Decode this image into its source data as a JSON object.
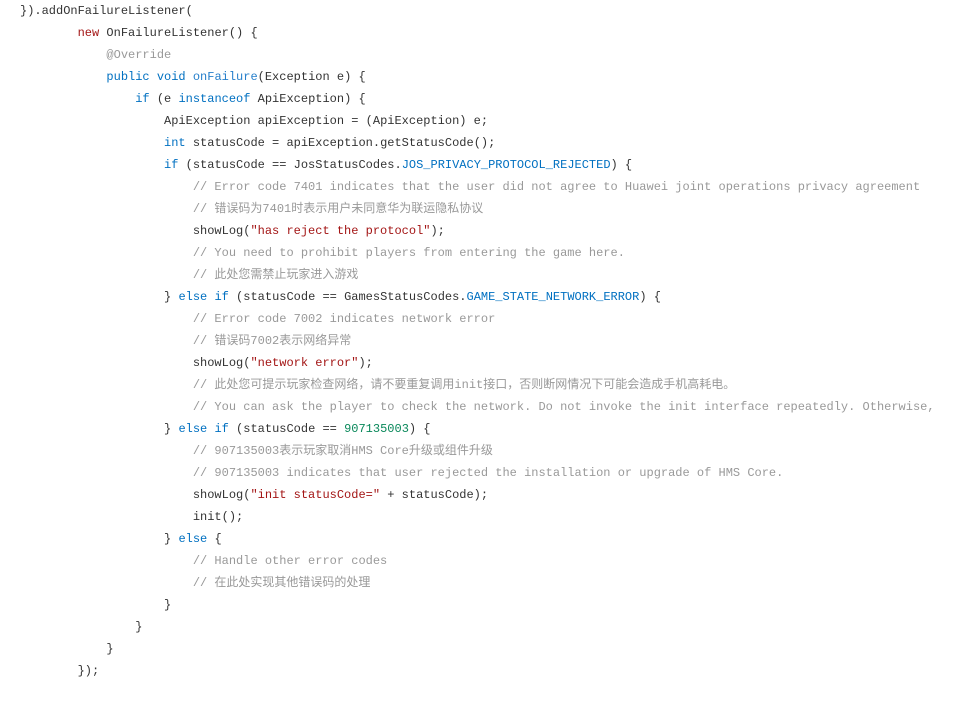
{
  "l0": "}).addOnFailureListener(",
  "l1_new": "new",
  "l1_rest": " OnFailureListener() {",
  "l2": "@Override",
  "l3_kw": "public void",
  "l3_method": " onFailure",
  "l3_rest": "(Exception e) {",
  "l4_kw1": "if",
  "l4_mid": " (e ",
  "l4_kw2": "instanceof",
  "l4_rest": " ApiException) {",
  "l5": "ApiException apiException = (ApiException) e;",
  "l6_kw": "int",
  "l6_rest": " statusCode = apiException.getStatusCode();",
  "l7_kw": "if",
  "l7_a": " (statusCode == JosStatusCodes.",
  "l7_const": "JOS_PRIVACY_PROTOCOL_REJECTED",
  "l7_b": ") {",
  "l8": "// Error code 7401 indicates that the user did not agree to Huawei joint operations privacy agreement",
  "l9": "// 错误码为7401时表示用户未同意华为联运隐私协议",
  "l10_a": "showLog(",
  "l10_str": "\"has reject the protocol\"",
  "l10_b": ");",
  "l11": "// You need to prohibit players from entering the game here.",
  "l12": "// 此处您需禁止玩家进入游戏",
  "l13_a": "} ",
  "l13_kw1": "else if",
  "l13_b": " (statusCode == GamesStatusCodes.",
  "l13_const": "GAME_STATE_NETWORK_ERROR",
  "l13_c": ") {",
  "l14": "// Error code 7002 indicates network error",
  "l15": "// 错误码7002表示网络异常",
  "l16_a": "showLog(",
  "l16_str": "\"network error\"",
  "l16_b": ");",
  "l17": "// 此处您可提示玩家检查网络，请不要重复调用init接口，否则断网情况下可能会造成手机高耗电。",
  "l18": "// You can ask the player to check the network. Do not invoke the init interface repeatedly. Otherwise,",
  "l19_a": "} ",
  "l19_kw": "else if",
  "l19_b": " (statusCode == ",
  "l19_num": "907135003",
  "l19_c": ") {",
  "l20": "// 907135003表示玩家取消HMS Core升级或组件升级",
  "l21": "// 907135003 indicates that user rejected the installation or upgrade of HMS Core.",
  "l22_a": "showLog(",
  "l22_str": "\"init statusCode=\"",
  "l22_b": " + statusCode);",
  "l23": "init();",
  "l24_a": "} ",
  "l24_kw": "else",
  "l24_b": " {",
  "l25": "// Handle other error codes",
  "l26": "// 在此处实现其他错误码的处理",
  "l27": "}",
  "l28": "}",
  "l29": "}",
  "l30": "});"
}
